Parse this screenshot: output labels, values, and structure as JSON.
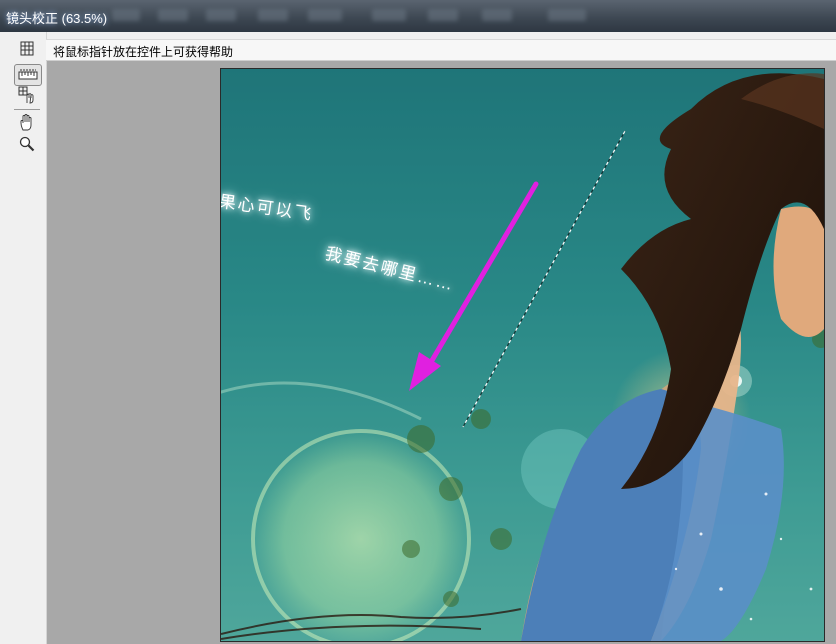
{
  "window": {
    "title": "镜头校正 (63.5%)"
  },
  "toolbar": {
    "tools": [
      {
        "name": "remove-distortion-icon"
      },
      {
        "name": "straighten-icon"
      },
      {
        "name": "move-grid-icon"
      },
      {
        "name": "hand-icon"
      },
      {
        "name": "zoom-icon"
      }
    ]
  },
  "hint": {
    "text": "将鼠标指针放在控件上可获得帮助"
  },
  "photo": {
    "text_line1": "果心可以飞",
    "text_line2": "我要去哪里……",
    "colors": {
      "arrow": "#e020e0",
      "sky": "#2c8c8a"
    }
  }
}
